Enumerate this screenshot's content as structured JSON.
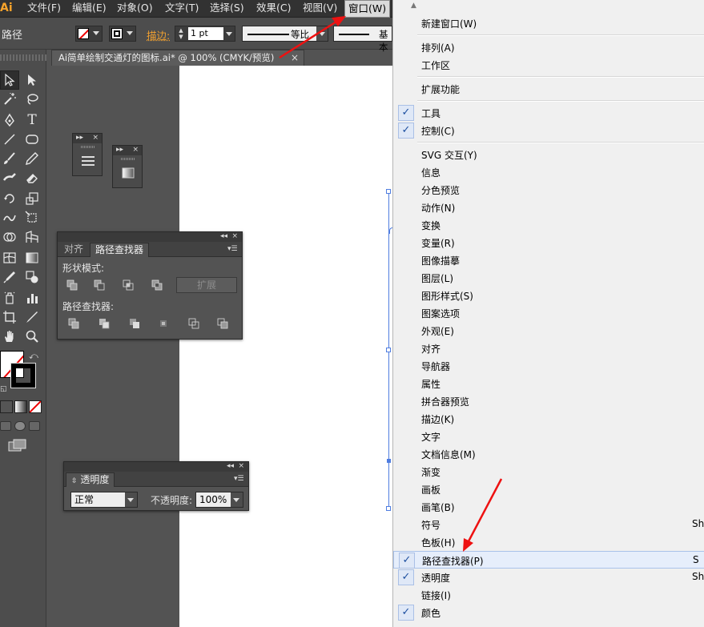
{
  "app": {
    "logo": "Ai"
  },
  "menubar": {
    "items": [
      {
        "label": "文件(F)"
      },
      {
        "label": "编辑(E)"
      },
      {
        "label": "对象(O)"
      },
      {
        "label": "文字(T)"
      },
      {
        "label": "选择(S)"
      },
      {
        "label": "效果(C)"
      },
      {
        "label": "视图(V)"
      },
      {
        "label": "窗口(W)"
      }
    ],
    "active_index": 7
  },
  "control": {
    "selection_label": "路径",
    "stroke_label": "描边:",
    "stroke_weight": "1 pt",
    "profile_1": "等比",
    "profile_2": "基本"
  },
  "document": {
    "tab_title": "Ai简单绘制交通灯的图标.ai* @ 100% (CMYK/预览)",
    "close": "×"
  },
  "pathfinder_panel": {
    "tab_align": "对齐",
    "tab_pathfinder": "路径查找器",
    "shape_modes_label": "形状模式:",
    "expand_label": "扩展",
    "pathfinders_label": "路径查找器:",
    "collapse_glyph": "◂◂",
    "close_glyph": "×"
  },
  "transparency_panel": {
    "tab": "透明度",
    "blend_mode": "正常",
    "opacity_label": "不透明度:",
    "opacity_value": "100%",
    "collapse_glyph": "◂◂",
    "close_glyph": "×"
  },
  "mini_panels": [
    {
      "expand_glyph": "▸▸",
      "close_glyph": "×",
      "icon": "align-lines-icon"
    },
    {
      "expand_glyph": "▸▸",
      "close_glyph": "×",
      "icon": "gradient-swatch-icon"
    }
  ],
  "window_menu": {
    "items": [
      {
        "label": "新建窗口(W)",
        "checked": false,
        "shortcut": ""
      },
      {
        "label": "排列(A)",
        "checked": false,
        "shortcut": ""
      },
      {
        "label": "工作区",
        "checked": false,
        "shortcut": ""
      },
      {
        "label": "扩展功能",
        "checked": false,
        "shortcut": ""
      },
      {
        "label": "工具",
        "checked": true,
        "shortcut": ""
      },
      {
        "label": "控制(C)",
        "checked": true,
        "shortcut": ""
      },
      {
        "label": "SVG 交互(Y)",
        "checked": false,
        "shortcut": ""
      },
      {
        "label": "信息",
        "checked": false,
        "shortcut": ""
      },
      {
        "label": "分色预览",
        "checked": false,
        "shortcut": ""
      },
      {
        "label": "动作(N)",
        "checked": false,
        "shortcut": ""
      },
      {
        "label": "变换",
        "checked": false,
        "shortcut": ""
      },
      {
        "label": "变量(R)",
        "checked": false,
        "shortcut": ""
      },
      {
        "label": "图像描摹",
        "checked": false,
        "shortcut": ""
      },
      {
        "label": "图层(L)",
        "checked": false,
        "shortcut": ""
      },
      {
        "label": "图形样式(S)",
        "checked": false,
        "shortcut": ""
      },
      {
        "label": "图案选项",
        "checked": false,
        "shortcut": ""
      },
      {
        "label": "外观(E)",
        "checked": false,
        "shortcut": ""
      },
      {
        "label": "对齐",
        "checked": false,
        "shortcut": ""
      },
      {
        "label": "导航器",
        "checked": false,
        "shortcut": ""
      },
      {
        "label": "属性",
        "checked": false,
        "shortcut": ""
      },
      {
        "label": "拼合器预览",
        "checked": false,
        "shortcut": ""
      },
      {
        "label": "描边(K)",
        "checked": false,
        "shortcut": ""
      },
      {
        "label": "文字",
        "checked": false,
        "shortcut": ""
      },
      {
        "label": "文档信息(M)",
        "checked": false,
        "shortcut": ""
      },
      {
        "label": "渐变",
        "checked": false,
        "shortcut": ""
      },
      {
        "label": "画板",
        "checked": false,
        "shortcut": ""
      },
      {
        "label": "画笔(B)",
        "checked": false,
        "shortcut": ""
      },
      {
        "label": "符号",
        "checked": false,
        "shortcut": "Sh"
      },
      {
        "label": "色板(H)",
        "checked": false,
        "shortcut": ""
      },
      {
        "label": "路径查找器(P)",
        "checked": true,
        "shortcut": "S"
      },
      {
        "label": "透明度",
        "checked": true,
        "shortcut": "Sh"
      },
      {
        "label": "链接(I)",
        "checked": false,
        "shortcut": ""
      },
      {
        "label": "颜色",
        "checked": true,
        "shortcut": ""
      }
    ],
    "highlighted_index": 29,
    "check_glyph": "✓",
    "scroll_up_glyph": "▲"
  },
  "colors": {
    "accent_highlight": "#e6eefb",
    "annotation_arrow": "#ee1111",
    "stroke_label": "#f0a030",
    "logo": "#f7a32b"
  }
}
